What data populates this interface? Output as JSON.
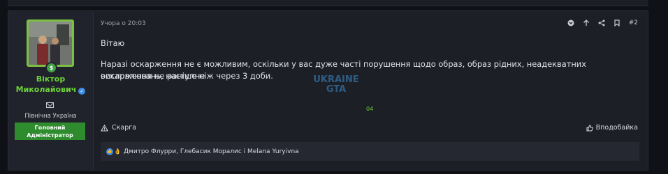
{
  "post": {
    "timestamp": "Учора о 20:03",
    "number": "#2",
    "greeting": "Вітаю",
    "body_line1": "Наразі оскарження не є можливим, оскільки у вас дуже часті порушення щодо образ, образ рідних, неадекватних висловлювань, наступне",
    "body_line2": "оскарження не раніше ніж через 3 доби.",
    "watermark": "UKRAINE GTA",
    "page_marker": "04",
    "report_label": "Скарга",
    "like_label": "Вподобайка",
    "reactions_text": "Дмитро Флурри, Глебасик Моралис і Melana Yuryivna"
  },
  "author": {
    "name_line1": "Віктор",
    "name_line2": "Миколайович",
    "location": "Північна Україна",
    "role_line1": "Головний",
    "role_line2": "Адміністратор",
    "avatar_badge": "$"
  },
  "icons": {
    "bookmark_toggle": "chevron-circle-icon",
    "up": "arrow-up-icon",
    "share": "share-icon",
    "bookmark": "bookmark-icon"
  },
  "colors": {
    "accent_green": "#6dd13a",
    "role_bg": "#2e8b2e",
    "avatar_border": "#7bc043",
    "panel_bg": "#1d1f27"
  }
}
